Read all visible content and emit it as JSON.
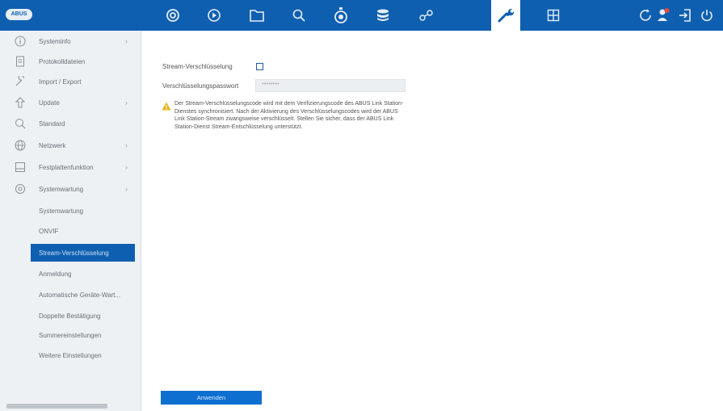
{
  "brand": {
    "logo_text": "ABUS"
  },
  "topbar": {
    "icons": [
      "camera-icon",
      "playback-icon",
      "folder-icon",
      "search-icon",
      "alarm-icon",
      "storage-icon",
      "network-icon",
      "tools-icon",
      "layout-icon",
      "refresh-icon",
      "user-icon",
      "logout-icon",
      "power-icon"
    ],
    "active": "tools-icon"
  },
  "sidebar": {
    "items": [
      {
        "label": "Systeminfo",
        "icon": "info-icon",
        "has_children": true
      },
      {
        "label": "Protokolldateien",
        "icon": "log-file-icon",
        "has_children": false
      },
      {
        "label": "Import / Export",
        "icon": "import-export-icon",
        "has_children": false
      },
      {
        "label": "Update",
        "icon": "upload-icon",
        "has_children": true
      },
      {
        "label": "Standard",
        "icon": "default-icon",
        "has_children": false
      },
      {
        "label": "Netzwerk",
        "icon": "globe-icon",
        "has_children": true
      },
      {
        "label": "Festplattenfunktion",
        "icon": "disk-icon",
        "has_children": true
      },
      {
        "label": "Systemwartung",
        "icon": "maintenance-icon",
        "has_children": true
      }
    ],
    "sub_items": [
      {
        "label": "Systemwartung",
        "selected": false
      },
      {
        "label": "ONVIF",
        "selected": false
      },
      {
        "label": "Stream-Verschlüsselung",
        "selected": true
      },
      {
        "label": "Anmeldung",
        "selected": false
      },
      {
        "label": "Automatische Geräte-Wart...",
        "selected": false
      },
      {
        "label": "Doppelte Bestätigung",
        "selected": false
      },
      {
        "label": "Summereinstellungen",
        "selected": false
      },
      {
        "label": "Weitere Einstellungen",
        "selected": false
      }
    ]
  },
  "form": {
    "encryption_label": "Stream-Verschlüsselung",
    "encryption_checked": false,
    "password_label": "Verschlüsselungspasswort",
    "password_value": "********",
    "warning_text": "Der Stream-Verschlüsselungscode wird mit dem Verifizierungscode des ABUS Link Station-Dienstes synchronisiert. Nach der Aktivierung des Verschlüsselungscodes wird der ABUS Link Station-Stream zwangsweise verschlüsselt. Stellen Sie sicher, dass der ABUS Link Station-Dienst Stream-Entschlüsselung unterstützt."
  },
  "actions": {
    "apply_label": "Anwenden"
  },
  "colors": {
    "accent": "#0f5fb0",
    "button": "#0f6fd1",
    "warning": "#e8b41c"
  }
}
